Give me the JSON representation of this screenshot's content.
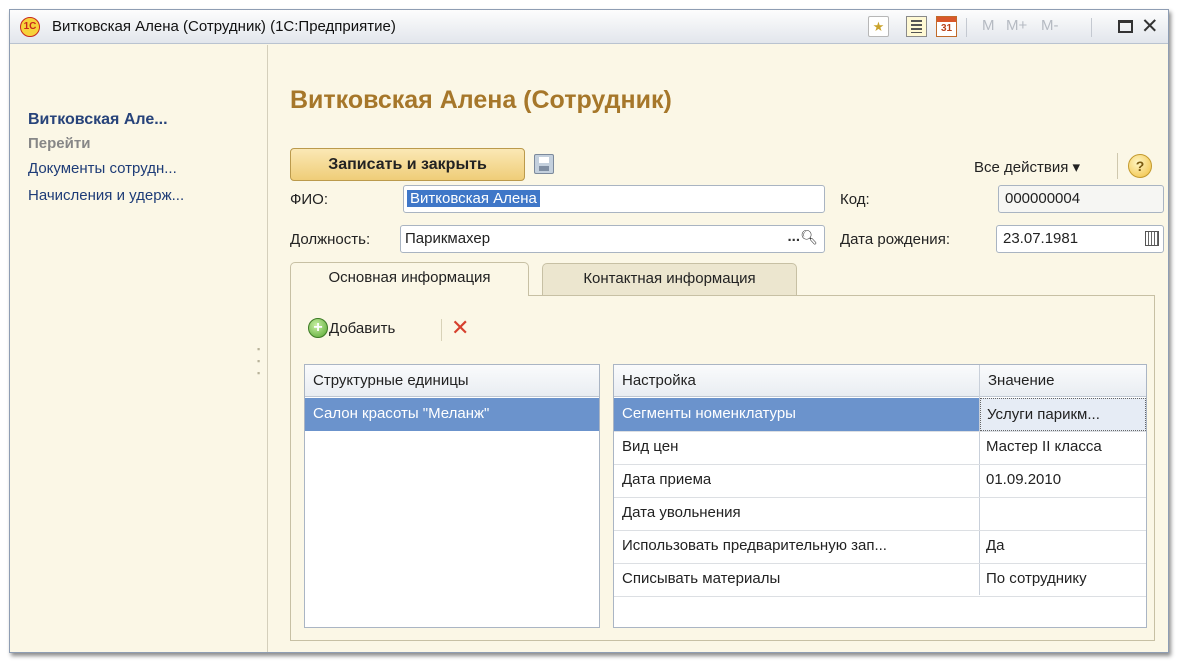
{
  "window": {
    "title": "Витковская Алена (Сотрудник)  (1С:Предприятие)",
    "logo": "1С",
    "toolbar": {
      "calendar_day": "31",
      "m": "M",
      "m_plus": "M+",
      "m_minus": "M-"
    }
  },
  "sidebar": {
    "title": "Витковская Але...",
    "section": "Перейти",
    "links": [
      "Документы сотрудн...",
      "Начисления и удерж..."
    ]
  },
  "form": {
    "title": "Витковская Алена (Сотрудник)",
    "save_button": "Записать и закрыть",
    "all_actions": "Все действия ▾",
    "help": "?",
    "fio_label": "ФИО:",
    "fio_value": "Витковская Алена",
    "code_label": "Код:",
    "code_value": "000000004",
    "position_label": "Должность:",
    "position_value": "Парикмахер",
    "dots": "...",
    "birth_label": "Дата рождения:",
    "birth_value": "23.07.1981"
  },
  "tabs": [
    {
      "label": "Основная информация",
      "active": true
    },
    {
      "label": "Контактная информация",
      "active": false
    }
  ],
  "panel": {
    "add_label": "Добавить",
    "units_table": {
      "header": "Структурные единицы",
      "rows": [
        "Салон красоты \"Меланж\""
      ]
    },
    "settings_table": {
      "headers": [
        "Настройка",
        "Значение"
      ],
      "rows": [
        {
          "setting": "Сегменты номенклатуры",
          "value": "Услуги парикм..."
        },
        {
          "setting": "Вид цен",
          "value": "Мастер II класса"
        },
        {
          "setting": "Дата приема",
          "value": "01.09.2010"
        },
        {
          "setting": "Дата увольнения",
          "value": ""
        },
        {
          "setting": "Использовать предварительную зап...",
          "value": "Да"
        },
        {
          "setting": "Списывать материалы",
          "value": "По сотруднику"
        }
      ]
    }
  }
}
